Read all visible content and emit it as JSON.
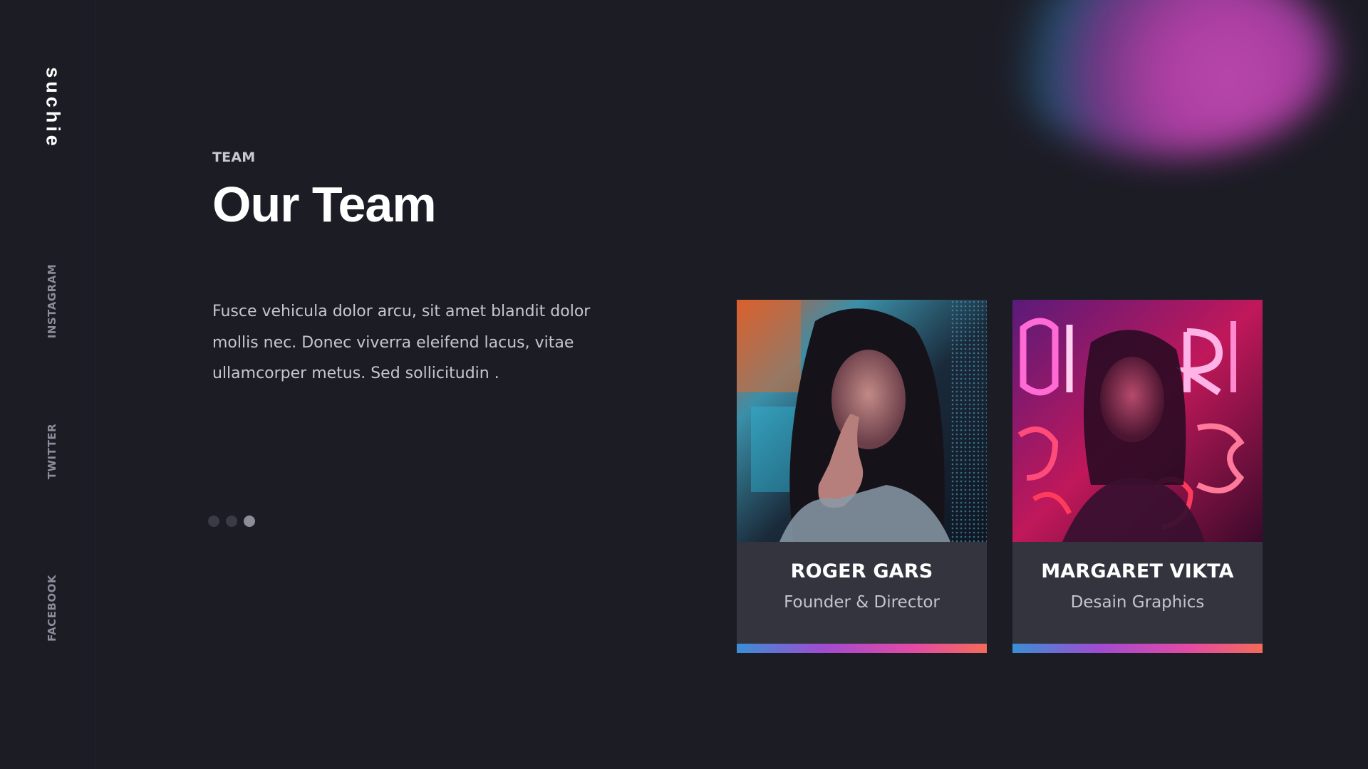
{
  "sidebar": {
    "brand": "suchie",
    "social": {
      "instagram": "INSTAGRAM",
      "twitter": "TWITTER",
      "facebook": "FACEBOOK"
    }
  },
  "section": {
    "eyebrow": "TEAM",
    "title": "Our Team",
    "description": "Fusce vehicula dolor arcu, sit amet blandit dolor mollis nec. Donec viverra eleifend lacus, vitae ullamcorper metus. Sed sollicitudin ."
  },
  "pagination": {
    "total": 3,
    "active_index": 2
  },
  "team": [
    {
      "name": "ROGER GARS",
      "role": "Founder & Director"
    },
    {
      "name": "MARGARET VIKTA",
      "role": "Desain Graphics"
    }
  ],
  "colors": {
    "background": "#1c1c25",
    "card": "#34343f",
    "accent_gradient": [
      "#3a8fd6",
      "#a14bd0",
      "#e34aa5",
      "#f46a5a"
    ],
    "blob": "#c44bb4"
  }
}
